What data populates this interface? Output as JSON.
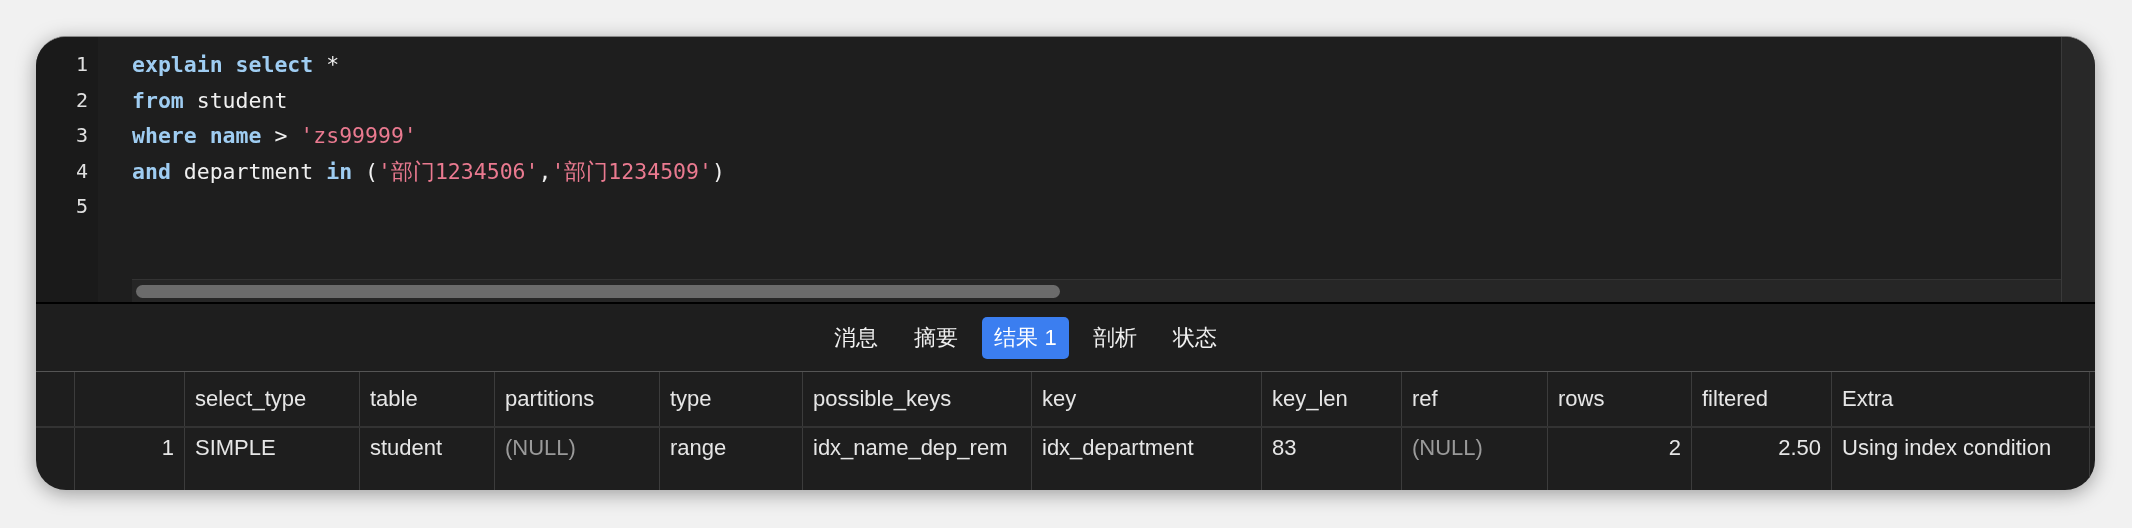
{
  "editor": {
    "lines": [
      {
        "number": "1",
        "tokens": [
          {
            "kind": "keyword",
            "text": "explain"
          },
          {
            "kind": "keyword",
            "text": " select"
          },
          {
            "kind": "plain",
            "text": " *"
          }
        ]
      },
      {
        "number": "2",
        "tokens": [
          {
            "kind": "keyword",
            "text": "from"
          },
          {
            "kind": "plain",
            "text": " student"
          }
        ]
      },
      {
        "number": "3",
        "tokens": [
          {
            "kind": "keyword",
            "text": "where"
          },
          {
            "kind": "keyword",
            "text": " name"
          },
          {
            "kind": "plain",
            "text": " > "
          },
          {
            "kind": "string",
            "text": "'zs99999'"
          }
        ]
      },
      {
        "number": "4",
        "tokens": [
          {
            "kind": "keyword",
            "text": "and"
          },
          {
            "kind": "plain",
            "text": " department "
          },
          {
            "kind": "keyword",
            "text": "in"
          },
          {
            "kind": "plain",
            "text": " ("
          },
          {
            "kind": "string",
            "text": "'部门1234506'"
          },
          {
            "kind": "plain",
            "text": ","
          },
          {
            "kind": "string",
            "text": "'部门1234509'"
          },
          {
            "kind": "plain",
            "text": ")"
          }
        ]
      },
      {
        "number": "5"
      }
    ]
  },
  "result_tabs": [
    {
      "label": "消息",
      "selected": false
    },
    {
      "label": "摘要",
      "selected": false
    },
    {
      "label": "结果 1",
      "selected": true
    },
    {
      "label": "剖析",
      "selected": false
    },
    {
      "label": "状态",
      "selected": false
    }
  ],
  "table": {
    "columns": [
      "select_type",
      "table",
      "partitions",
      "type",
      "possible_keys",
      "key",
      "key_len",
      "ref",
      "rows",
      "filtered",
      "Extra"
    ],
    "rows": [
      {
        "index": "1",
        "cells": [
          {
            "kind": "text",
            "text": "SIMPLE"
          },
          {
            "kind": "text",
            "text": "student"
          },
          {
            "kind": "null",
            "text": "(NULL)"
          },
          {
            "kind": "text",
            "text": "range"
          },
          {
            "kind": "text",
            "text": "idx_name_dep_rem"
          },
          {
            "kind": "text",
            "text": "idx_department"
          },
          {
            "kind": "text",
            "text": "83"
          },
          {
            "kind": "null",
            "text": "(NULL)"
          },
          {
            "kind": "number",
            "text": "2"
          },
          {
            "kind": "number",
            "text": "2.50"
          },
          {
            "kind": "text",
            "text": "Using index condition"
          }
        ]
      }
    ]
  }
}
